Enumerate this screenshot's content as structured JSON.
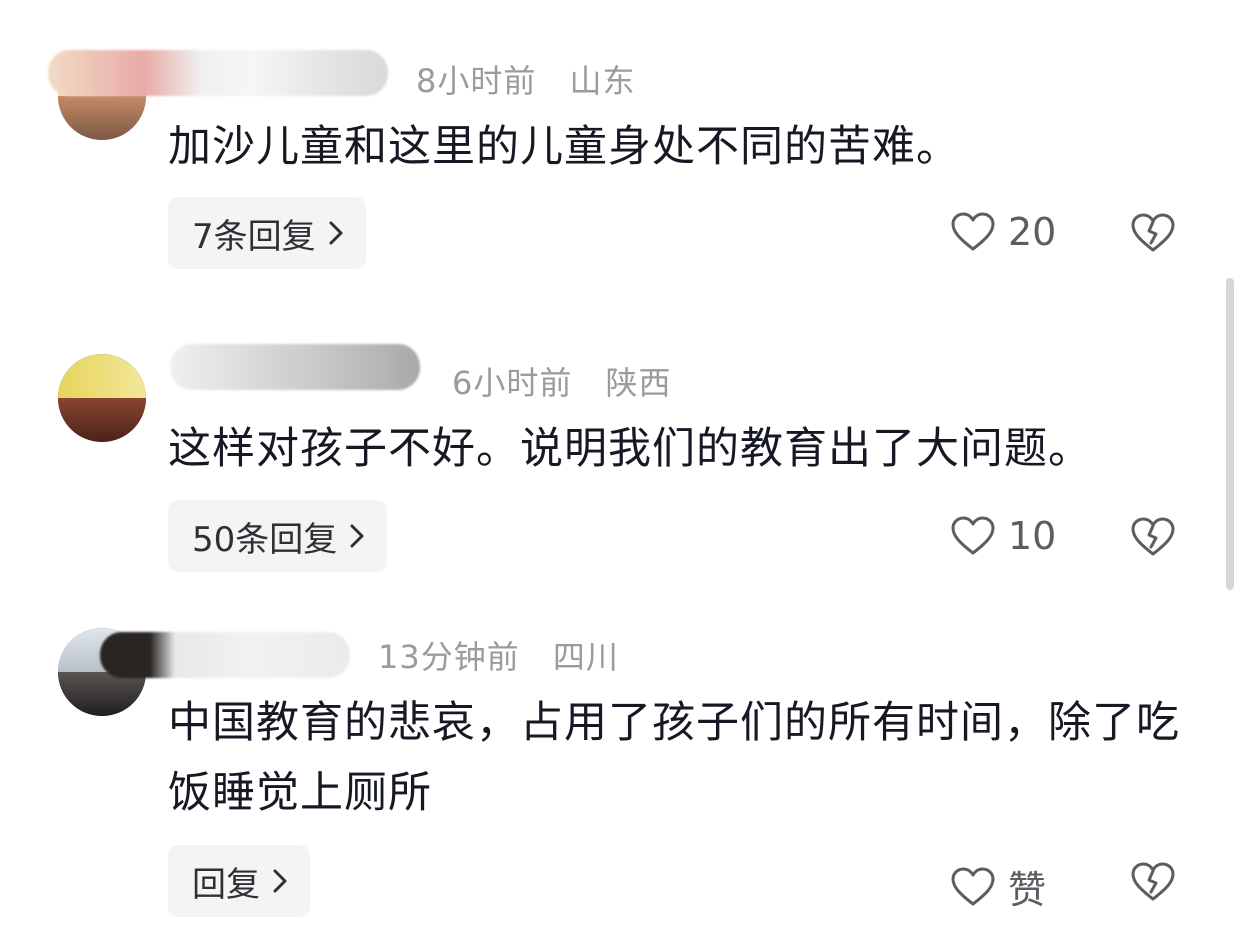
{
  "comments": [
    {
      "time": "8小时前",
      "location": "山东",
      "text": "加沙儿童和这里的儿童身处不同的苦难。",
      "reply_label": "7条回复",
      "like_count": "20"
    },
    {
      "time": "6小时前",
      "location": "陕西",
      "text": "这样对孩子不好。说明我们的教育出了大问题。",
      "reply_label": "50条回复",
      "like_count": "10"
    },
    {
      "time": "13分钟前",
      "location": "四川",
      "text": "中国教育的悲哀，占用了孩子们的所有时间，除了吃饭睡觉上厕所",
      "reply_label": "回复",
      "like_count": "赞"
    }
  ],
  "icons": {
    "like": "heart-outline-icon",
    "dislike": "broken-heart-icon",
    "reply_arrow": "chevron-right-icon"
  },
  "colors": {
    "text": "#161823",
    "meta": "#9a9ba0",
    "button_bg": "#f4f4f5"
  }
}
